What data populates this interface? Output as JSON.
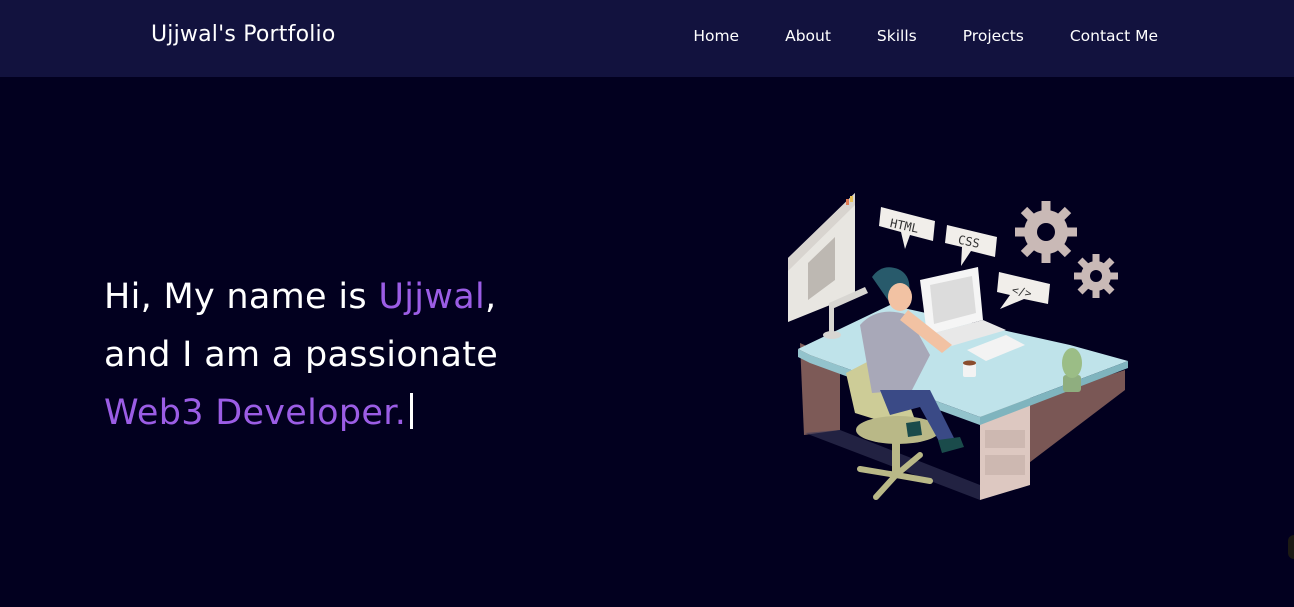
{
  "header": {
    "brand": "Ujjwal's Portfolio",
    "nav": [
      {
        "label": "Home"
      },
      {
        "label": "About"
      },
      {
        "label": "Skills"
      },
      {
        "label": "Projects"
      },
      {
        "label": "Contact Me"
      }
    ]
  },
  "hero": {
    "line1_prefix": "Hi, My name is ",
    "name": "Ujjwal",
    "line1_suffix": ",",
    "line2": "and I am a passionate",
    "role": "Web3 Developer."
  },
  "illustration": {
    "bubble_html": "HTML",
    "bubble_css": "CSS",
    "bubble_code": "</>"
  },
  "colors": {
    "background": "#02001f",
    "navbar": "#12123e",
    "accent": "#9b5de5",
    "text": "#ffffff"
  }
}
